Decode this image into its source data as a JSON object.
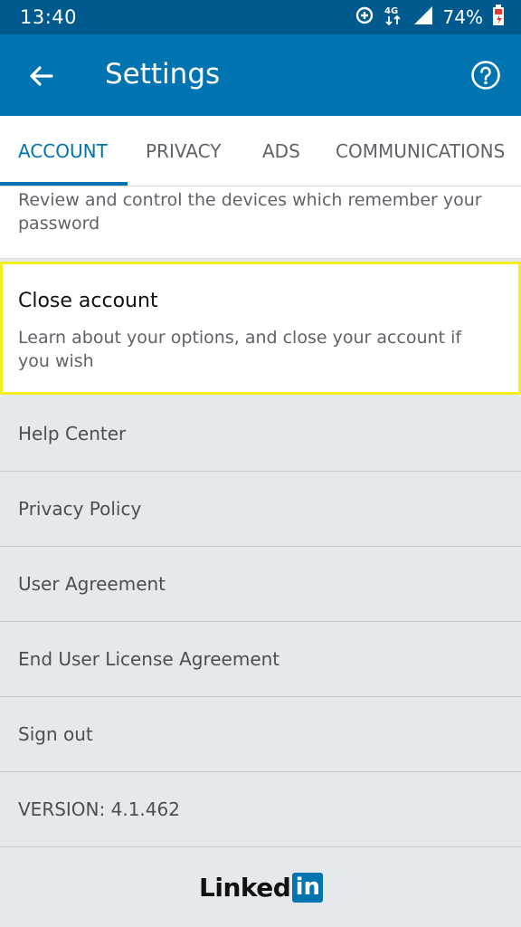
{
  "status_bar": {
    "time": "13:40",
    "network": "4G",
    "battery_percent": "74%",
    "icons": [
      "data-saver-icon",
      "network-4g-icon",
      "signal-icon",
      "battery-charging-icon"
    ]
  },
  "app_bar": {
    "title": "Settings",
    "back_icon": "arrow-back-icon",
    "help_icon": "help-circle-icon",
    "background": "#0073b1"
  },
  "tabs": [
    {
      "label": "ACCOUNT",
      "active": true
    },
    {
      "label": "PRIVACY",
      "active": false
    },
    {
      "label": "ADS",
      "active": false
    },
    {
      "label": "COMMUNICATIONS",
      "active": false
    }
  ],
  "devices_card": {
    "description": "Review and control the devices which remember your password"
  },
  "close_account_card": {
    "title": "Close account",
    "description": "Learn about your options, and close your account if you wish",
    "highlight_color": "#f2ee1f"
  },
  "links": [
    {
      "label": "Help Center"
    },
    {
      "label": "Privacy Policy"
    },
    {
      "label": "User Agreement"
    },
    {
      "label": "End User License Agreement"
    },
    {
      "label": "Sign out"
    }
  ],
  "version": "VERSION: 4.1.462",
  "footer": {
    "logo_word": "Linked",
    "logo_badge": "in",
    "brand_color": "#0073b1"
  }
}
